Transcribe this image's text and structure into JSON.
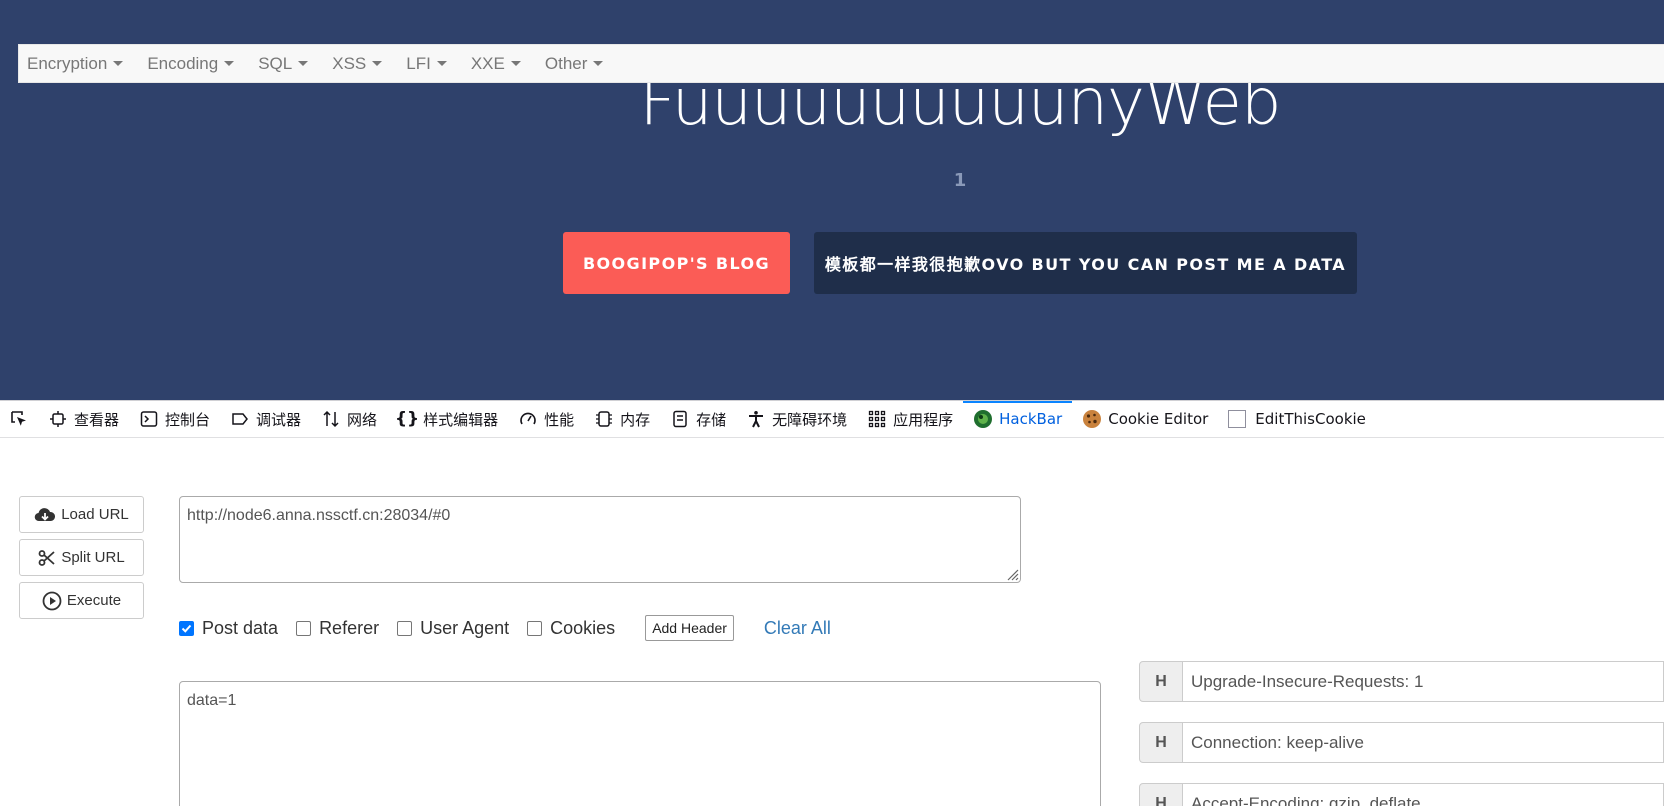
{
  "hero": {
    "title": "FuuuuuuuuuunyWeb",
    "counter": "1",
    "buttons": [
      "BOOGIPOP'S BLOG",
      "模板都一样我很抱歉OVO BUT YOU CAN POST ME A DATA"
    ]
  },
  "devtools": {
    "tabs": [
      {
        "label": "查看器",
        "icon": "inspector-icon"
      },
      {
        "label": "控制台",
        "icon": "console-icon"
      },
      {
        "label": "调试器",
        "icon": "debugger-icon"
      },
      {
        "label": "网络",
        "icon": "network-icon"
      },
      {
        "label": "样式编辑器",
        "icon": "style-editor-icon"
      },
      {
        "label": "性能",
        "icon": "performance-icon"
      },
      {
        "label": "内存",
        "icon": "memory-icon"
      },
      {
        "label": "存储",
        "icon": "storage-icon"
      },
      {
        "label": "无障碍环境",
        "icon": "accessibility-icon"
      },
      {
        "label": "应用程序",
        "icon": "application-icon"
      },
      {
        "label": "HackBar",
        "icon": "hackbar-icon",
        "active": true
      },
      {
        "label": "Cookie Editor",
        "icon": "cookie-icon"
      },
      {
        "label": "EditThisCookie",
        "icon": "checkbox-icon"
      }
    ],
    "accent_color": "#0060df"
  },
  "hackbar": {
    "menu": [
      "Encryption",
      "Encoding",
      "SQL",
      "XSS",
      "LFI",
      "XXE",
      "Other"
    ],
    "side_buttons": {
      "load": "Load URL",
      "split": "Split URL",
      "execute": "Execute"
    },
    "url": "http://node6.anna.nssctf.cn:28034/#0",
    "checks": {
      "post": "Post data",
      "referer": "Referer",
      "user_agent": "User Agent",
      "cookies": "Cookies"
    },
    "post_checked": true,
    "add_header": "Add Header",
    "clear_all": "Clear All",
    "post_body": "data=1",
    "headers": {
      "key_label": "H",
      "rows": [
        "Upgrade-Insecure-Requests: 1",
        "Connection: keep-alive",
        "Accept-Encoding: gzip, deflate"
      ]
    }
  }
}
